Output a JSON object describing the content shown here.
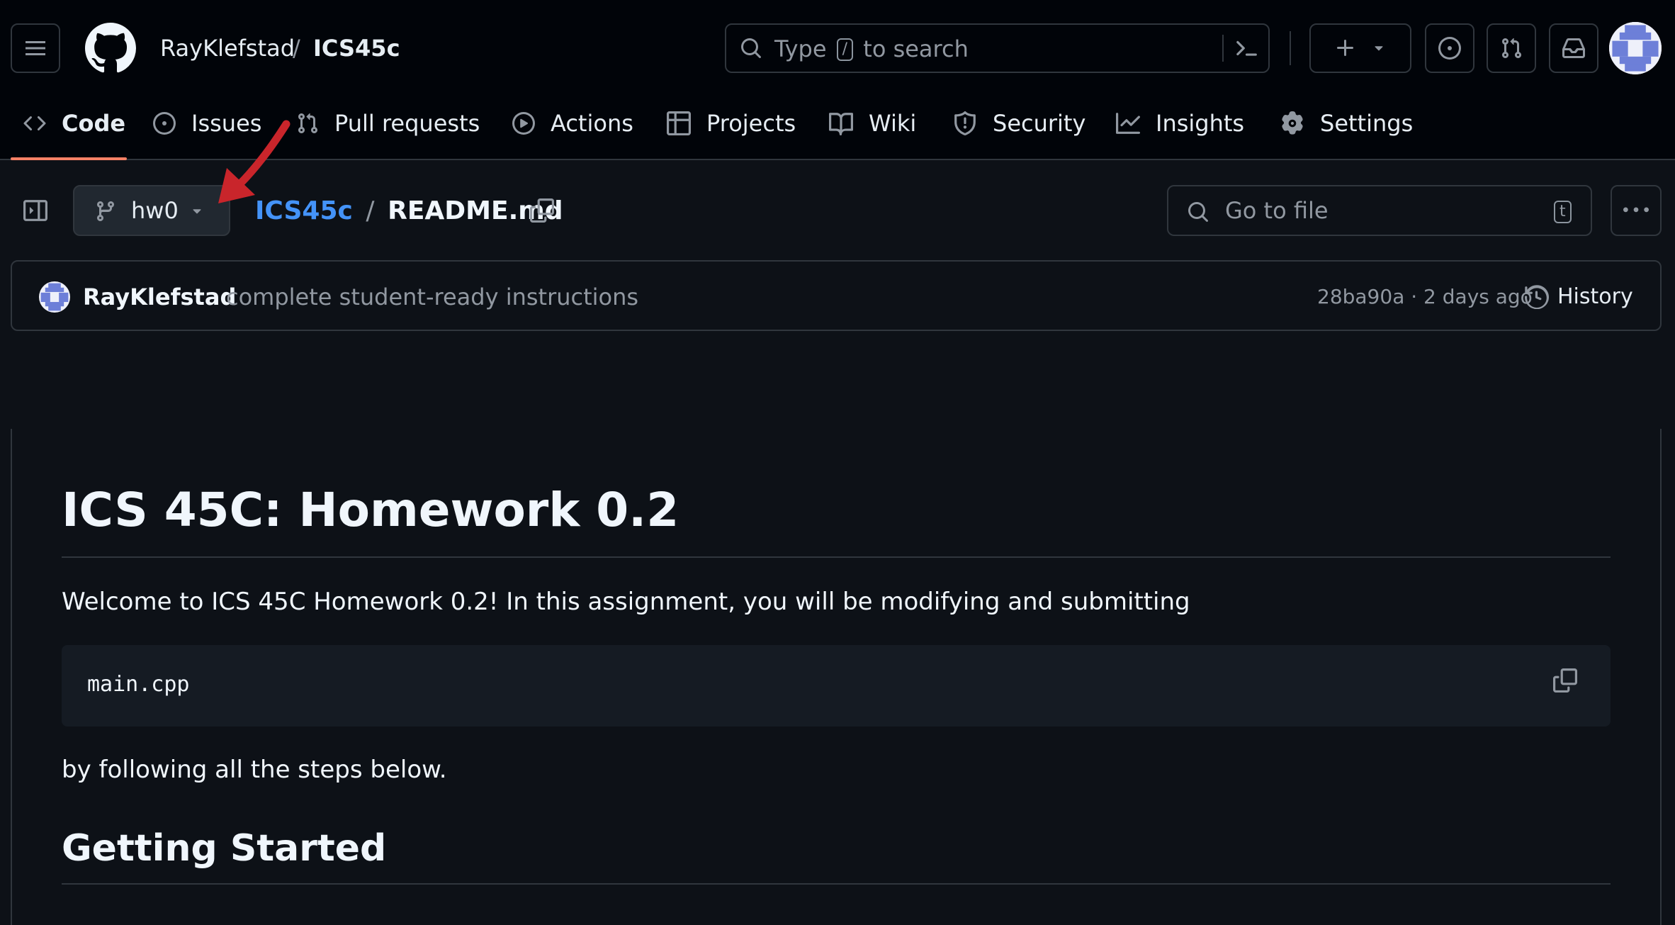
{
  "header": {
    "owner": "RayKlefstad",
    "separator": "/",
    "repo": "ICS45c",
    "search": {
      "prefix": "Type",
      "key": "/",
      "suffix": "to search"
    }
  },
  "tabs": [
    {
      "label": "Code",
      "icon": "code-icon",
      "active": true
    },
    {
      "label": "Issues",
      "icon": "issue-opened-icon"
    },
    {
      "label": "Pull requests",
      "icon": "git-pull-request-icon"
    },
    {
      "label": "Actions",
      "icon": "play-icon"
    },
    {
      "label": "Projects",
      "icon": "table-icon"
    },
    {
      "label": "Wiki",
      "icon": "book-icon"
    },
    {
      "label": "Security",
      "icon": "shield-icon"
    },
    {
      "label": "Insights",
      "icon": "graph-icon"
    },
    {
      "label": "Settings",
      "icon": "gear-icon"
    }
  ],
  "file_bar": {
    "branch": "hw0",
    "repo_link": "ICS45c",
    "path_sep": "/",
    "filename": "README.md",
    "goto_placeholder": "Go to file",
    "goto_key": "t"
  },
  "commit": {
    "author": "RayKlefstad",
    "message": "complete student-ready instructions",
    "meta": "28ba90a · 2 days ago",
    "history_label": "History"
  },
  "readme": {
    "title": "ICS 45C: Homework 0.2",
    "intro": "Welcome to ICS 45C Homework 0.2! In this assignment, you will be modifying and submitting",
    "code": "main.cpp",
    "after": "by following all the steps below.",
    "heading2": "Getting Started"
  },
  "colors": {
    "accent_link": "#4493f8",
    "tab_underline": "#f78166",
    "annotation_arrow": "#c9252b",
    "avatar": "#6d7fd8"
  }
}
